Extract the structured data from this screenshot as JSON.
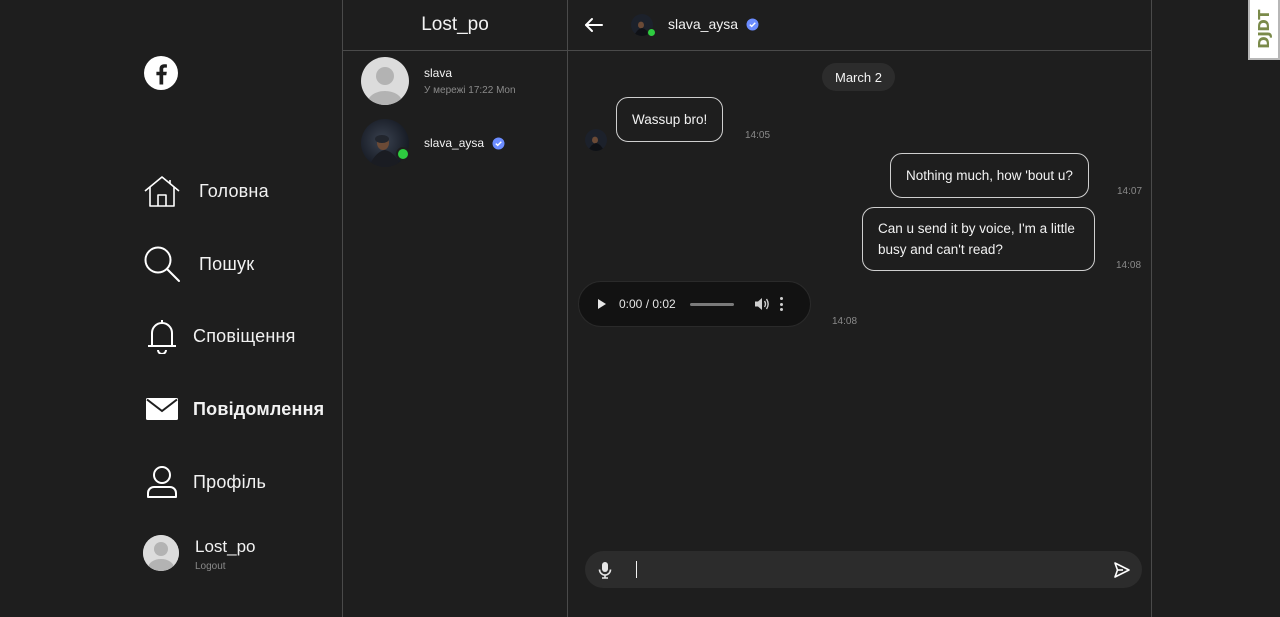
{
  "nav": {
    "items": [
      {
        "label": "Головна",
        "icon": "home-icon"
      },
      {
        "label": "Пошук",
        "icon": "search-icon"
      },
      {
        "label": "Сповіщення",
        "icon": "bell-icon"
      },
      {
        "label": "Повідомлення",
        "icon": "mail-icon",
        "active": true
      },
      {
        "label": "Профіль",
        "icon": "user-icon"
      }
    ],
    "user": {
      "name": "Lost_po",
      "logout": "Logout"
    }
  },
  "conversations": {
    "title": "Lost_po",
    "items": [
      {
        "name": "slava",
        "status": "У мережі 17:22 Mon",
        "verified": false,
        "online": false
      },
      {
        "name": "slava_aysa",
        "status": "",
        "verified": true,
        "online": true
      }
    ]
  },
  "chat": {
    "contact": "slava_aysa",
    "date": "March 2",
    "messages": [
      {
        "text": "Wassup bro!",
        "time": "14:05",
        "side": "incoming"
      },
      {
        "text": "Nothing much, how 'bout u?",
        "time": "14:07",
        "side": "outgoing"
      },
      {
        "text": "Can u send it by voice, I'm a little busy and can't read?",
        "time": "14:08",
        "side": "outgoing"
      },
      {
        "type": "audio",
        "time_display": "0:00 / 0:02",
        "time": "14:08",
        "side": "incoming"
      }
    ],
    "composer": {
      "value": "",
      "placeholder": ""
    }
  },
  "djdt": {
    "label": "DJDT"
  },
  "colors": {
    "background": "#1e1e1e",
    "border": "#4a4a4a",
    "verified": "#6b8cff",
    "online": "#2ecc40",
    "pill": "#2c2c2c"
  }
}
